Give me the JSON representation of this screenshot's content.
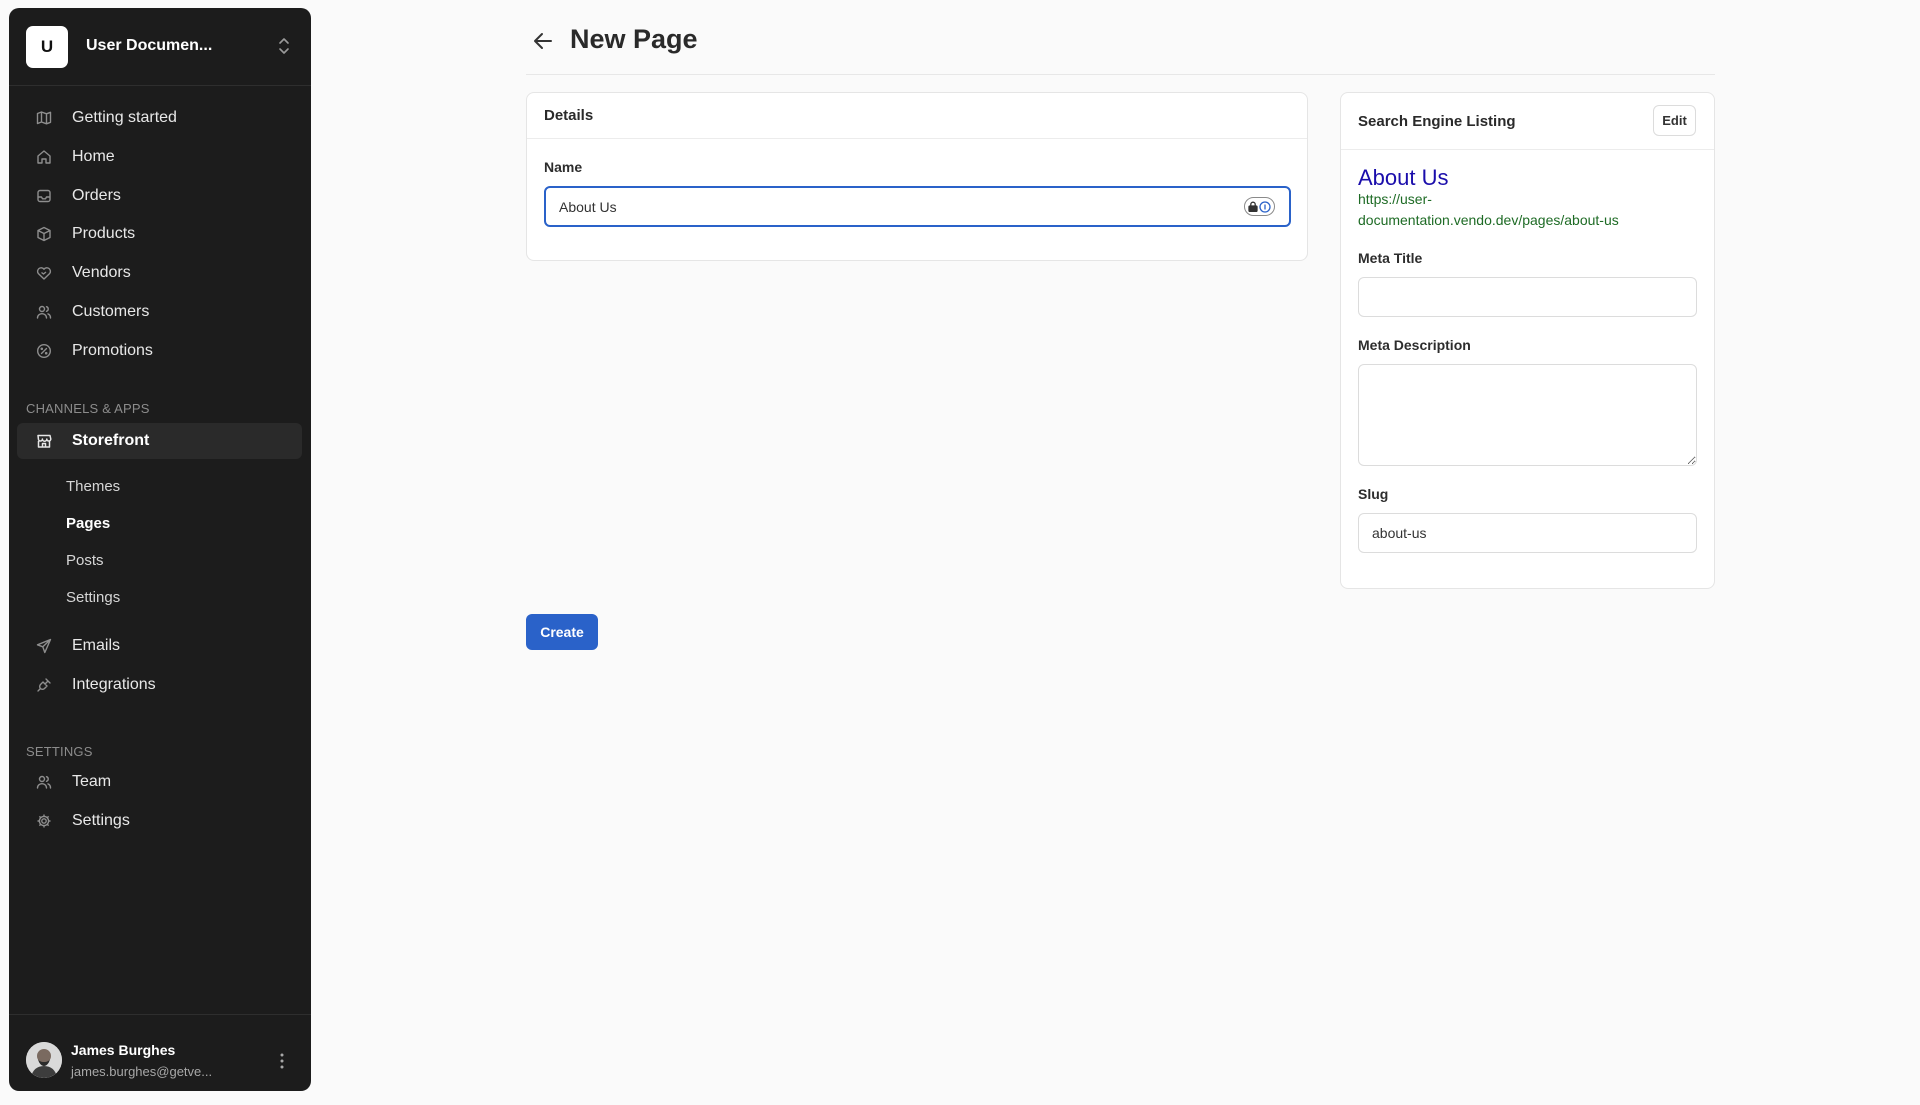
{
  "workspace": {
    "initial": "U",
    "name": "User Documen..."
  },
  "nav": {
    "main": [
      {
        "id": "getting-started",
        "label": "Getting started",
        "icon": "map-icon"
      },
      {
        "id": "home",
        "label": "Home",
        "icon": "home-icon"
      },
      {
        "id": "orders",
        "label": "Orders",
        "icon": "inbox-icon"
      },
      {
        "id": "products",
        "label": "Products",
        "icon": "box-icon"
      },
      {
        "id": "vendors",
        "label": "Vendors",
        "icon": "handshake-icon"
      },
      {
        "id": "customers",
        "label": "Customers",
        "icon": "users-icon"
      },
      {
        "id": "promotions",
        "label": "Promotions",
        "icon": "percent-icon"
      }
    ],
    "channels_label": "CHANNELS & APPS",
    "storefront": {
      "label": "Storefront",
      "icon": "store-icon"
    },
    "storefront_sub": [
      "Themes",
      "Pages",
      "Posts",
      "Settings"
    ],
    "storefront_active_sub": "Pages",
    "apps": [
      {
        "id": "emails",
        "label": "Emails",
        "icon": "send-icon"
      },
      {
        "id": "integrations",
        "label": "Integrations",
        "icon": "plug-icon"
      }
    ],
    "settings_label": "SETTINGS",
    "settings": [
      {
        "id": "team",
        "label": "Team",
        "icon": "users-icon"
      },
      {
        "id": "settings",
        "label": "Settings",
        "icon": "gear-icon"
      }
    ]
  },
  "user": {
    "name": "James Burghes",
    "email": "james.burghes@getve..."
  },
  "page": {
    "title": "New Page"
  },
  "details": {
    "title": "Details",
    "name_label": "Name",
    "name_value": "About Us"
  },
  "seo": {
    "title": "Search Engine Listing",
    "edit_label": "Edit",
    "preview_title": "About Us",
    "preview_url": "https://user-documentation.vendo.dev/pages/about-us",
    "meta_title_label": "Meta Title",
    "meta_title_value": "",
    "meta_description_label": "Meta Description",
    "meta_description_value": "",
    "slug_label": "Slug",
    "slug_value": "about-us"
  },
  "actions": {
    "create_label": "Create"
  },
  "colors": {
    "accent": "#2a62c9",
    "sidebar_bg": "#1c1c1c",
    "seo_title": "#1a0dab",
    "seo_url": "#1e6b25"
  }
}
